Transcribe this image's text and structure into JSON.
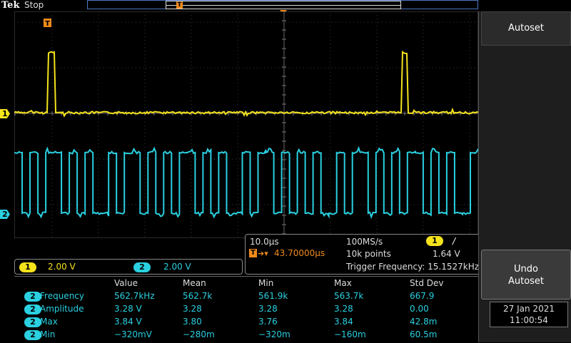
{
  "brand": "Tek",
  "run_state": "Stop",
  "trigger_marker": "T",
  "channels": [
    {
      "id": "1",
      "scale": "2.00 V",
      "color": "#f5e31c"
    },
    {
      "id": "2",
      "scale": "2.00 V",
      "color": "#2ad0e0"
    }
  ],
  "horizontal": {
    "time_per_div": "10.0µs",
    "trigger_icon": "T",
    "position": "43.70000µs",
    "sample_rate": "100MS/s",
    "record_length": "10k points",
    "trigger_channel": "1",
    "trigger_slope": "/",
    "trigger_level": "1.64 V",
    "trigger_frequency": "Trigger Frequency: 15.1527kHz"
  },
  "measurements": {
    "headers": [
      "Value",
      "Mean",
      "Min",
      "Max",
      "Std Dev"
    ],
    "rows": [
      {
        "ch": "2",
        "name": "Frequency",
        "value": "562.7kHz",
        "mean": "562.7k",
        "min": "561.9k",
        "max": "563.7k",
        "std": "667.9"
      },
      {
        "ch": "2",
        "name": "Amplitude",
        "value": "3.28 V",
        "mean": "3.28",
        "min": "3.28",
        "max": "3.28",
        "std": "0.00"
      },
      {
        "ch": "2",
        "name": "Max",
        "value": "3.84 V",
        "mean": "3.80",
        "min": "3.76",
        "max": "3.84",
        "std": "42.8m"
      },
      {
        "ch": "2",
        "name": "Min",
        "value": "−320mV",
        "mean": "−280m",
        "min": "−320m",
        "max": "−160m",
        "std": "60.5m"
      }
    ]
  },
  "side_menu": {
    "autoset_label": "Autoset",
    "undo_label_line1": "Undo",
    "undo_label_line2": "Autoset"
  },
  "datetime": {
    "date": "27 Jan  2021",
    "time": "11:00:54"
  },
  "colors": {
    "ch1": "#f5e31c",
    "ch2": "#2ad0e0",
    "trigger": "#f08a1c"
  }
}
